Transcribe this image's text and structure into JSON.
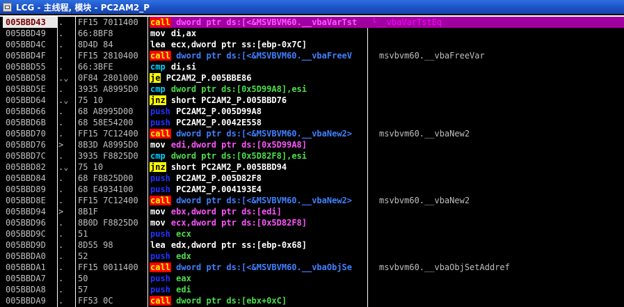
{
  "window": {
    "title": "LCG - 主线程, 模块 - PC2AM2_P",
    "icon": "ollydbg-window-icon"
  },
  "rows": [
    {
      "addr": "005BBD43",
      "mark": ".",
      "bytes": "FF15 7011400",
      "mn": "call",
      "ops": "dword ptr ds:[<&MSVBVM60.__vbaVarTst",
      "cmt": "└__vbaVarTstEq",
      "type": "call-jump",
      "selected": true
    },
    {
      "addr": "005BBD49",
      "mark": ".",
      "bytes": "66:8BF8",
      "mn": "mov",
      "ops": "di,ax",
      "cmt": "",
      "type": "mov"
    },
    {
      "addr": "005BBD4C",
      "mark": ".",
      "bytes": "8D4D 84",
      "mn": "lea",
      "ops": "ecx,dword ptr ss:[ebp-0x7C]",
      "cmt": "",
      "type": "lea"
    },
    {
      "addr": "005BBD4F",
      "mark": ".",
      "bytes": "FF15 2810400",
      "mn": "call",
      "ops": "dword ptr ds:[<&MSVBVM60.__vbaFreeV",
      "cmt": "msvbvm60.__vbaFreeVar",
      "type": "call-mem"
    },
    {
      "addr": "005BBD55",
      "mark": ".",
      "bytes": "66:3BFE",
      "mn": "cmp",
      "ops": "di,si",
      "cmt": "",
      "type": "cmp-reg"
    },
    {
      "addr": "005BBD58",
      "mark": ".⌄",
      "bytes": "0F84 2801000",
      "mn": "je",
      "ops": "PC2AM2_P.005BBE86",
      "cmt": "",
      "type": "jcc"
    },
    {
      "addr": "005BBD5E",
      "mark": ".",
      "bytes": "3935 A8995D0",
      "mn": "cmp",
      "ops": "dword ptr ds:[0x5D99A8],esi",
      "cmt": "",
      "type": "cmp-mem"
    },
    {
      "addr": "005BBD64",
      "mark": ".⌄",
      "bytes": "75 10",
      "mn": "jnz",
      "ops": "short PC2AM2_P.005BBD76",
      "cmt": "",
      "type": "jcc"
    },
    {
      "addr": "005BBD66",
      "mark": ".",
      "bytes": "68 A8995D00",
      "mn": "push",
      "ops": "PC2AM2_P.005D99A8",
      "cmt": "",
      "type": "push-imm"
    },
    {
      "addr": "005BBD6B",
      "mark": ".",
      "bytes": "68 58E54200",
      "mn": "push",
      "ops": "PC2AM2_P.0042E558",
      "cmt": "",
      "type": "push-imm"
    },
    {
      "addr": "005BBD70",
      "mark": ".",
      "bytes": "FF15 7C12400",
      "mn": "call",
      "ops": "dword ptr ds:[<&MSVBVM60.__vbaNew2>",
      "cmt": "msvbvm60.__vbaNew2",
      "type": "call-mem"
    },
    {
      "addr": "005BBD76",
      "mark": ">",
      "bytes": "8B3D A8995D0",
      "mn": "mov",
      "ops": "edi,dword ptr ds:[0x5D99A8]",
      "cmt": "",
      "type": "mov-mem"
    },
    {
      "addr": "005BBD7C",
      "mark": ".",
      "bytes": "3935 F8825D0",
      "mn": "cmp",
      "ops": "dword ptr ds:[0x5D82F8],esi",
      "cmt": "",
      "type": "cmp-mem"
    },
    {
      "addr": "005BBD82",
      "mark": ".⌄",
      "bytes": "75 10",
      "mn": "jnz",
      "ops": "short PC2AM2_P.005BBD94",
      "cmt": "",
      "type": "jcc"
    },
    {
      "addr": "005BBD84",
      "mark": ".",
      "bytes": "68 F8825D00",
      "mn": "push",
      "ops": "PC2AM2_P.005D82F8",
      "cmt": "",
      "type": "push-imm"
    },
    {
      "addr": "005BBD89",
      "mark": ".",
      "bytes": "68 E4934100",
      "mn": "push",
      "ops": "PC2AM2_P.004193E4",
      "cmt": "",
      "type": "push-imm"
    },
    {
      "addr": "005BBD8E",
      "mark": ".",
      "bytes": "FF15 7C12400",
      "mn": "call",
      "ops": "dword ptr ds:[<&MSVBVM60.__vbaNew2>",
      "cmt": "msvbvm60.__vbaNew2",
      "type": "call-mem"
    },
    {
      "addr": "005BBD94",
      "mark": ">",
      "bytes": "8B1F",
      "mn": "mov",
      "ops": "ebx,dword ptr ds:[edi]",
      "cmt": "",
      "type": "mov-mem"
    },
    {
      "addr": "005BBD96",
      "mark": ".",
      "bytes": "8B0D F8825D0",
      "mn": "mov",
      "ops": "ecx,dword ptr ds:[0x5D82F8]",
      "cmt": "",
      "type": "mov-mem"
    },
    {
      "addr": "005BBD9C",
      "mark": ".",
      "bytes": "51",
      "mn": "push",
      "ops": "ecx",
      "cmt": "",
      "type": "push-reg"
    },
    {
      "addr": "005BBD9D",
      "mark": ".",
      "bytes": "8D55 98",
      "mn": "lea",
      "ops": "edx,dword ptr ss:[ebp-0x68]",
      "cmt": "",
      "type": "lea"
    },
    {
      "addr": "005BBDA0",
      "mark": ".",
      "bytes": "52",
      "mn": "push",
      "ops": "edx",
      "cmt": "",
      "type": "push-reg"
    },
    {
      "addr": "005BBDA1",
      "mark": ".",
      "bytes": "FF15 0011400",
      "mn": "call",
      "ops": "dword ptr ds:[<&MSVBVM60.__vbaObjSe",
      "cmt": "msvbvm60.__vbaObjSetAddref",
      "type": "call-mem"
    },
    {
      "addr": "005BBDA7",
      "mark": ".",
      "bytes": "50",
      "mn": "push",
      "ops": "eax",
      "cmt": "",
      "type": "push-reg"
    },
    {
      "addr": "005BBDA8",
      "mark": ".",
      "bytes": "57",
      "mn": "push",
      "ops": "edi",
      "cmt": "",
      "type": "push-reg"
    },
    {
      "addr": "005BBDA9",
      "mark": ".",
      "bytes": "FF53 0C",
      "mn": "call",
      "ops": "dword ptr ds:[ebx+0xC]",
      "cmt": "",
      "type": "call-reg"
    }
  ],
  "colors": {
    "background": "#000000",
    "selected_row": "#a000a0",
    "call_bg": "#ff0000",
    "call_fg": "#ffff00",
    "jcc_bg": "#ffff00",
    "push_fg": "#2233ff",
    "cmp_fg": "#00d0ff"
  }
}
